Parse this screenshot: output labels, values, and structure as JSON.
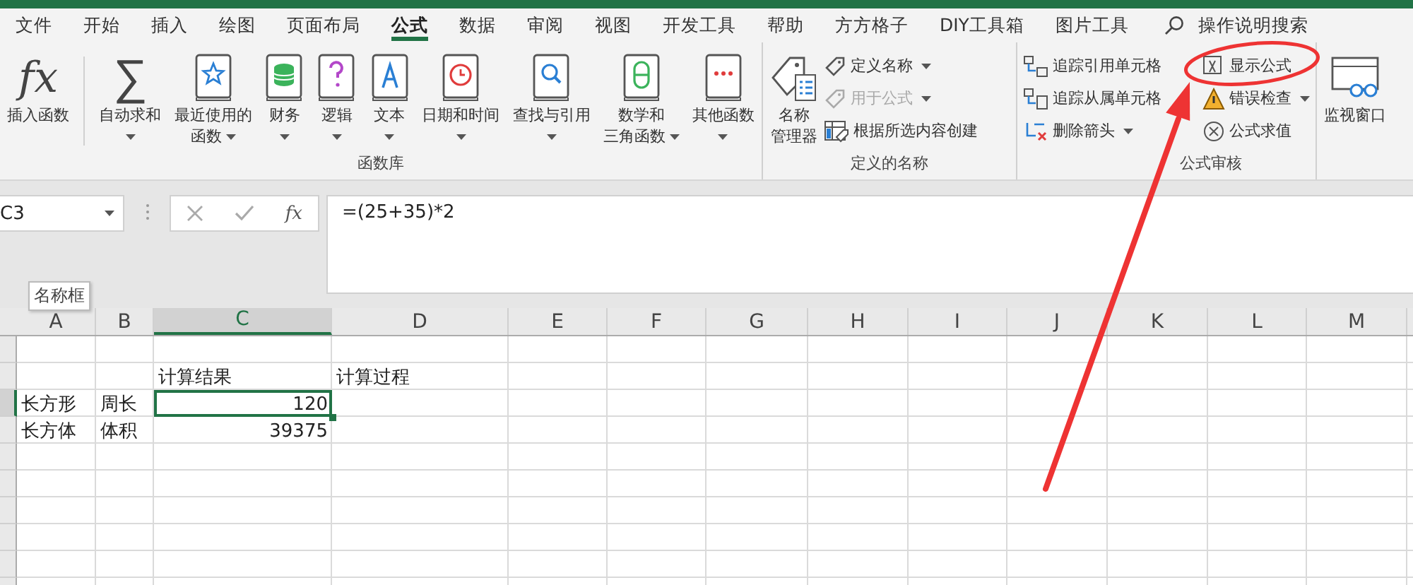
{
  "tabs": [
    {
      "label": "文件",
      "selected": false
    },
    {
      "label": "开始",
      "selected": false
    },
    {
      "label": "插入",
      "selected": false
    },
    {
      "label": "绘图",
      "selected": false
    },
    {
      "label": "页面布局",
      "selected": false
    },
    {
      "label": "公式",
      "selected": true
    },
    {
      "label": "数据",
      "selected": false
    },
    {
      "label": "审阅",
      "selected": false
    },
    {
      "label": "视图",
      "selected": false
    },
    {
      "label": "开发工具",
      "selected": false
    },
    {
      "label": "帮助",
      "selected": false
    },
    {
      "label": "方方格子",
      "selected": false
    },
    {
      "label": "DIY工具箱",
      "selected": false
    },
    {
      "label": "图片工具",
      "selected": false
    }
  ],
  "search": {
    "label": "操作说明搜索"
  },
  "ribbon": {
    "groups": [
      {
        "label": "函数库",
        "kind": "large",
        "items": [
          {
            "glyph": "fx",
            "lines": [
              "插入函数"
            ],
            "dropdown": false,
            "disabled": false
          },
          {
            "glyph": "∑",
            "lines": [
              "自动求和"
            ],
            "dropdown": true,
            "disabled": false
          },
          {
            "lines": [
              "最近使用的",
              "函数"
            ],
            "dropdown": true,
            "disabled": false
          },
          {
            "lines": [
              "财务"
            ],
            "dropdown": true,
            "disabled": false
          },
          {
            "lines": [
              "逻辑"
            ],
            "dropdown": true,
            "disabled": false
          },
          {
            "lines": [
              "文本"
            ],
            "dropdown": true,
            "disabled": false
          },
          {
            "lines": [
              "日期和时间"
            ],
            "dropdown": true,
            "disabled": false
          },
          {
            "lines": [
              "查找与引用"
            ],
            "dropdown": true,
            "disabled": false
          },
          {
            "lines": [
              "数学和",
              "三角函数"
            ],
            "dropdown": true,
            "disabled": false
          },
          {
            "lines": [
              "其他函数"
            ],
            "dropdown": true,
            "disabled": false
          }
        ]
      },
      {
        "label": "定义的名称",
        "kind": "mixed",
        "items": [
          {
            "lines": [
              "名称",
              "管理器"
            ],
            "dropdown": false,
            "disabled": false
          },
          {
            "lines": [
              "定义名称"
            ],
            "dropdown": true,
            "disabled": false
          },
          {
            "lines": [
              "用于公式"
            ],
            "dropdown": true,
            "disabled": true
          },
          {
            "lines": [
              "根据所选内容创建"
            ],
            "dropdown": false,
            "disabled": false
          }
        ]
      },
      {
        "label": "公式审核",
        "kind": "small",
        "items": [
          {
            "lines": [
              "追踪引用单元格"
            ],
            "dropdown": false,
            "disabled": false
          },
          {
            "lines": [
              "追踪从属单元格"
            ],
            "dropdown": false,
            "disabled": false
          },
          {
            "lines": [
              "删除箭头"
            ],
            "dropdown": true,
            "disabled": false
          },
          {
            "lines": [
              "显示公式"
            ],
            "dropdown": false,
            "disabled": false
          },
          {
            "lines": [
              "错误检查"
            ],
            "dropdown": true,
            "disabled": false
          },
          {
            "lines": [
              "公式求值"
            ],
            "dropdown": false,
            "disabled": false
          }
        ]
      },
      {
        "kind": "large",
        "items": [
          {
            "lines": [
              "监视窗口"
            ],
            "dropdown": false,
            "disabled": false
          }
        ]
      }
    ]
  },
  "formula_bar": {
    "name_box": "C3",
    "function_button": "fx",
    "formula": "=(25+35)*2"
  },
  "tooltip": "名称框",
  "sheet": {
    "columns": [
      {
        "label": "A",
        "selected": false
      },
      {
        "label": "B",
        "selected": false
      },
      {
        "label": "C",
        "selected": true
      },
      {
        "label": "D",
        "selected": false
      },
      {
        "label": "E",
        "selected": false
      },
      {
        "label": "F",
        "selected": false
      },
      {
        "label": "G",
        "selected": false
      },
      {
        "label": "H",
        "selected": false
      },
      {
        "label": "I",
        "selected": false
      },
      {
        "label": "J",
        "selected": false
      },
      {
        "label": "K",
        "selected": false
      },
      {
        "label": "L",
        "selected": false
      },
      {
        "label": "M",
        "selected": false
      }
    ],
    "rows": [
      {
        "selected": false,
        "cells": [
          null,
          null,
          null,
          null
        ]
      },
      {
        "selected": false,
        "cells": [
          null,
          null,
          {
            "text": "计算结果",
            "kind": "text",
            "selected": false
          },
          {
            "text": "计算过程",
            "kind": "text",
            "selected": false
          }
        ]
      },
      {
        "selected": true,
        "cells": [
          {
            "text": "长方形",
            "kind": "text",
            "selected": false
          },
          {
            "text": "周长",
            "kind": "text",
            "selected": false
          },
          {
            "text": "120",
            "kind": "number",
            "selected": true
          },
          null
        ]
      },
      {
        "selected": false,
        "cells": [
          {
            "text": "长方体",
            "kind": "text",
            "selected": false
          },
          {
            "text": "体积",
            "kind": "text",
            "selected": false
          },
          {
            "text": "39375",
            "kind": "number",
            "selected": false
          },
          null
        ]
      }
    ]
  },
  "annotation": {
    "kind": "arrow-to-ellipse"
  }
}
